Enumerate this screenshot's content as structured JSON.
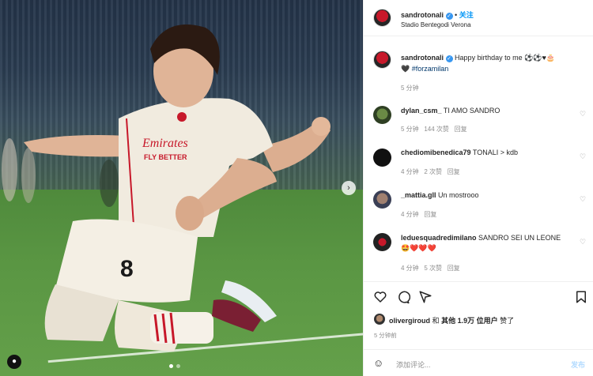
{
  "post": {
    "author": "sandrotonali",
    "follow_label": "关注",
    "location": "Stadio Bentegodi Verona",
    "caption_author": "sandrotonali",
    "caption_text": "Happy birthday to me ⚽⚽♥🎂",
    "caption_line2_emoji": "🖤",
    "caption_hashtag": "#forzamilan",
    "caption_time": "5 分钟"
  },
  "photo": {
    "usertag_icon": "person-icon",
    "next_icon": "chevron-right-icon",
    "jersey_number": "8",
    "sponsor_text": "Emirates\nFLY BETTER"
  },
  "comments": [
    {
      "user": "dylan_csm_",
      "text": "TI AMO SANDRO",
      "time": "5 分钟",
      "likes": "144 次赞",
      "reply": "回复"
    },
    {
      "user": "chediomibenedica79",
      "text": "TONALI > kdb",
      "time": "4 分钟",
      "likes": "2 次赞",
      "reply": "回复"
    },
    {
      "user": "_mattia.gll",
      "text": "Un mostrooo",
      "time": "4 分钟",
      "likes": "",
      "reply": "回复"
    },
    {
      "user": "leduesquadredimilano",
      "text": "SANDRO SEI UN LEONE",
      "text2": "🤩❤️❤️❤️",
      "time": "4 分钟",
      "likes": "5 次赞",
      "reply": "回复"
    }
  ],
  "likes": {
    "liker": "olivergiroud",
    "and": "和",
    "others": "其他 1.9万 位用户",
    "liked": "赞了",
    "time": "5 分钟前"
  },
  "add_comment": {
    "placeholder": "添加评论...",
    "post_label": "发布"
  },
  "colors": {
    "accent": "#0095f6",
    "verified": "#3897f0",
    "milan_red": "#c7182a"
  }
}
